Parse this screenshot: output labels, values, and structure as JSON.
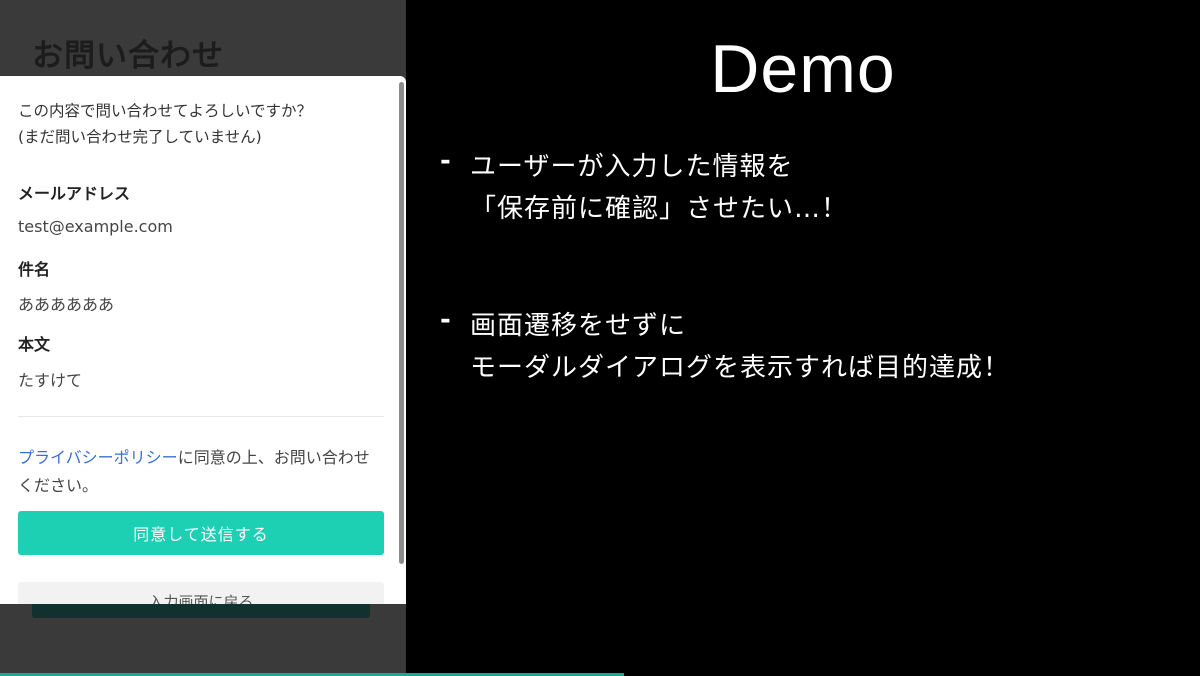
{
  "phone": {
    "page_title": "お問い合わせ",
    "back_button_label": "入力画面に戻る",
    "modal": {
      "confirm_line1": "この内容で問い合わせてよろしいですか？",
      "confirm_line2": "(まだ問い合わせ完了していません)",
      "fields": [
        {
          "label": "メールアドレス",
          "value": "test@example.com"
        },
        {
          "label": "件名",
          "value": "ああああああ"
        },
        {
          "label": "本文",
          "value": "たすけて"
        }
      ],
      "policy_link": "プライバシーポリシー",
      "policy_text": "に同意の上、お問い合わせください。",
      "agree_button": "同意して送信する"
    }
  },
  "slide": {
    "title": "Demo",
    "bullets": [
      {
        "dash": "-",
        "line1": "ユーザーが入力した情報を",
        "line2": "「保存前に確認」させたい…！"
      },
      {
        "dash": "-",
        "line1": "画面遷移をせずに",
        "line2": "モーダルダイアログを表示すれば目的達成！"
      }
    ]
  },
  "colors": {
    "accent": "#1dd0b4",
    "link": "#3b6fd8",
    "progress": "#19a897"
  }
}
